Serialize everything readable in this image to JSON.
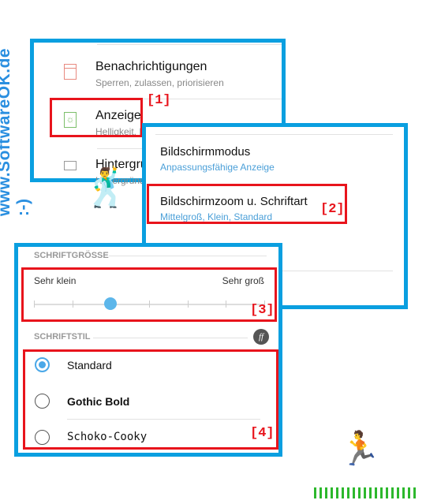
{
  "watermark": "www.SoftwareOK.de :-)",
  "colors": {
    "frame": "#0a9fe0",
    "highlight": "#e8141c",
    "accent": "#4aa8e8"
  },
  "panel1": {
    "items": [
      {
        "title": "Benachrichtigungen",
        "subtitle": "Sperren, zulassen, priorisieren",
        "icon": "notification-icon"
      },
      {
        "title": "Anzeige",
        "subtitle": "Helligkeit, B",
        "icon": "display-brightness-icon"
      },
      {
        "title": "Hintergrund",
        "subtitle": "Hintergründe",
        "icon": "paintbrush-icon"
      }
    ],
    "tag": "[1]"
  },
  "panel2": {
    "items": [
      {
        "title": "Bildschirmmodus",
        "subtitle": "Anpassungsfähige Anzeige"
      },
      {
        "title": "Bildschirmzoom u. Schriftart",
        "subtitle": "Mittelgroß, Klein, Standard"
      }
    ],
    "tag": "[2]"
  },
  "panel3": {
    "font_size_header": "SCHRIFTGRÖSSE",
    "slider": {
      "min_label": "Sehr klein",
      "max_label": "Sehr groß",
      "steps": 7,
      "value_index": 2
    },
    "tag3": "[3]",
    "font_style_header": "SCHRIFTSTIL",
    "ff_icon": "ff",
    "options": [
      {
        "label": "Standard",
        "selected": true
      },
      {
        "label": "Gothic Bold",
        "selected": false
      },
      {
        "label": "Schoko-Cooky",
        "selected": false
      }
    ],
    "tag4": "[4]"
  }
}
